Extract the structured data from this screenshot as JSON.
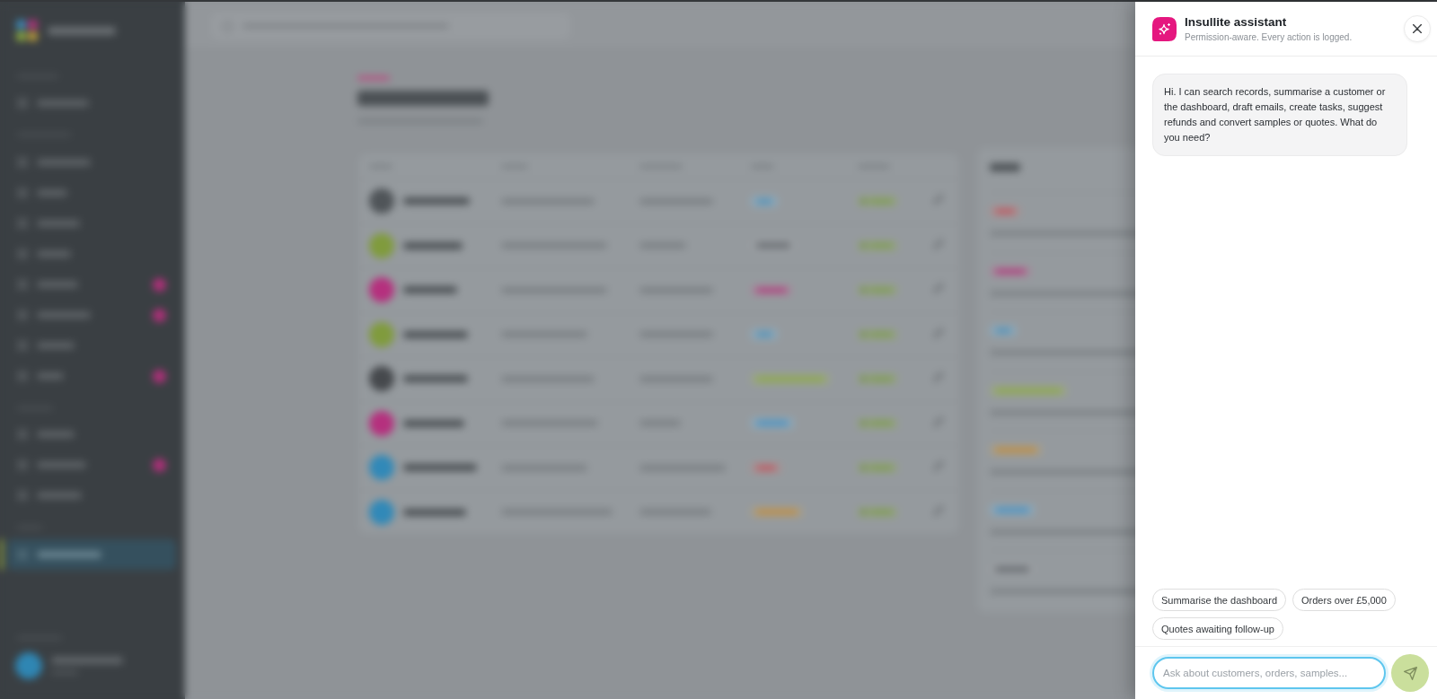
{
  "assistant": {
    "title": "Insullite assistant",
    "subtitle": "Permission-aware. Every action is logged."
  },
  "messages": [
    {
      "kind": "assistant",
      "text": "Hi. I can search records, summarise a customer or the dashboard, draft emails, create tasks, suggest refunds and convert samples or quotes. What do you need?"
    }
  ],
  "suggestions": [
    "Summarise the dashboard",
    "Orders over £5,000",
    "Quotes awaiting follow-up"
  ],
  "composer": {
    "placeholder": "Ask about customers, orders, samples...",
    "focused": true
  },
  "send_button": {
    "disabled": true
  }
}
